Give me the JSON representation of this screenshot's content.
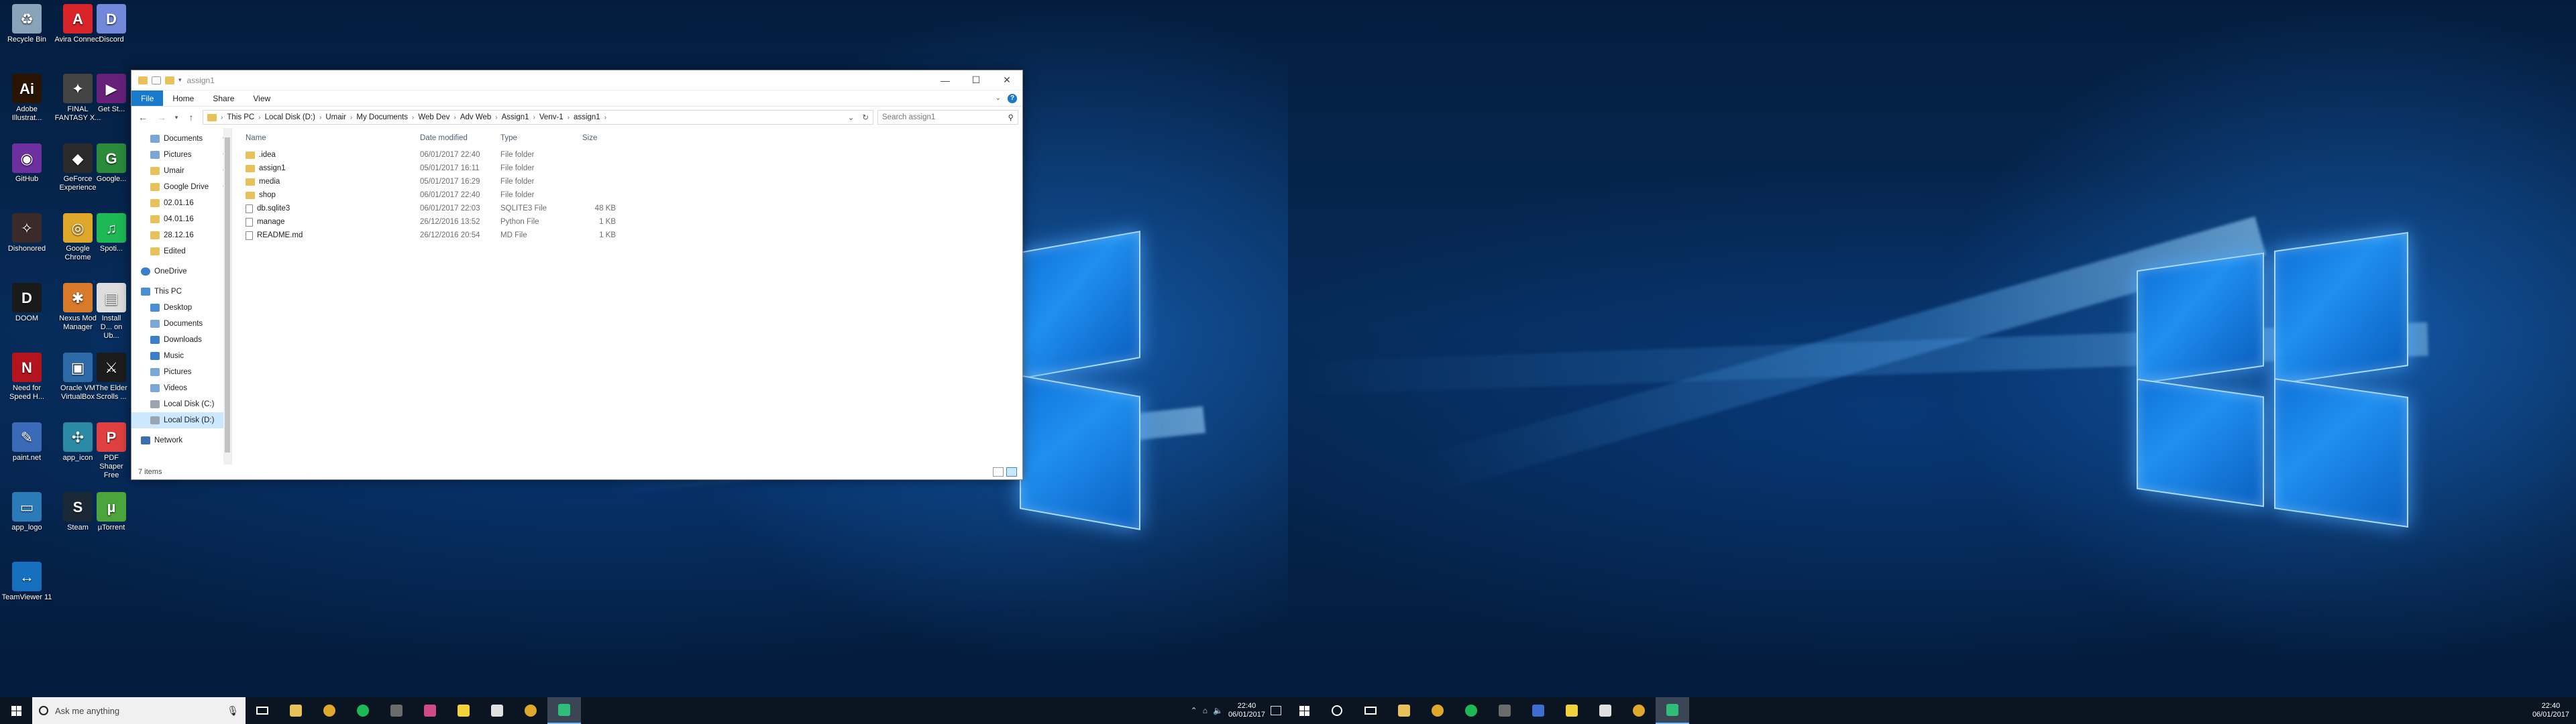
{
  "desktop_icons": [
    {
      "id": "recycle",
      "label": "Recycle Bin",
      "color": "#8aa3b8",
      "glyph": "♻"
    },
    {
      "id": "avira",
      "label": "Avira Connect",
      "color": "#d9252a",
      "glyph": "A"
    },
    {
      "id": "discord",
      "label": "Discord",
      "color": "#7289da",
      "glyph": "D"
    },
    {
      "id": "illustrator",
      "label": "Adobe Illustrat...",
      "color": "#2a1300",
      "glyph": "Ai"
    },
    {
      "id": "ffxv",
      "label": "FINAL FANTASY X...",
      "color": "#444",
      "glyph": "✦"
    },
    {
      "id": "getst",
      "label": "Get St...",
      "color": "#68217a",
      "glyph": "▶"
    },
    {
      "id": "github",
      "label": "GitHub",
      "color": "#6e2fa0",
      "glyph": "◉"
    },
    {
      "id": "geforce",
      "label": "GeForce Experience",
      "color": "#2b2b2b",
      "glyph": "◆"
    },
    {
      "id": "google",
      "label": "Google...",
      "color": "#2a8b3a",
      "glyph": "G"
    },
    {
      "id": "dishonored",
      "label": "Dishonored",
      "color": "#3a2a2a",
      "glyph": "✧"
    },
    {
      "id": "chrome",
      "label": "Google Chrome",
      "color": "#e0a82b",
      "glyph": "◎"
    },
    {
      "id": "spotify",
      "label": "Spoti...",
      "color": "#1db954",
      "glyph": "♫"
    },
    {
      "id": "doom",
      "label": "DOOM",
      "color": "#1a1a1a",
      "glyph": "D"
    },
    {
      "id": "nexus",
      "label": "Nexus Mod Manager",
      "color": "#d9792a",
      "glyph": "✱"
    },
    {
      "id": "install",
      "label": "Install D... on Ub...",
      "color": "#dddddd",
      "glyph": "▤"
    },
    {
      "id": "nfs",
      "label": "Need for Speed H...",
      "color": "#b4141e",
      "glyph": "N"
    },
    {
      "id": "virtualbox",
      "label": "Oracle VM VirtualBox",
      "color": "#2f6aa8",
      "glyph": "▣"
    },
    {
      "id": "skyrim",
      "label": "The Elder Scrolls ...",
      "color": "#1c1c1c",
      "glyph": "⚔"
    },
    {
      "id": "paintnet",
      "label": "paint.net",
      "color": "#3a6ab8",
      "glyph": "✎"
    },
    {
      "id": "appicon",
      "label": "app_icon",
      "color": "#2b8aa6",
      "glyph": "✣"
    },
    {
      "id": "pdfshaper",
      "label": "PDF Shaper Free",
      "color": "#e04040",
      "glyph": "P"
    },
    {
      "id": "applogo",
      "label": "app_logo",
      "color": "#2b7bb8",
      "glyph": "▭"
    },
    {
      "id": "steam",
      "label": "Steam",
      "color": "#1b2838",
      "glyph": "S"
    },
    {
      "id": "utorrent",
      "label": "µTorrent",
      "color": "#4ba53a",
      "glyph": "µ"
    },
    {
      "id": "teamviewer",
      "label": "TeamViewer 11",
      "color": "#1571c0",
      "glyph": "↔"
    }
  ],
  "explorer": {
    "title": "assign1",
    "ribbon_tabs": [
      "File",
      "Home",
      "Share",
      "View"
    ],
    "breadcrumb": [
      "This PC",
      "Local Disk (D:)",
      "Umair",
      "My Documents",
      "Web Dev",
      "Adv Web",
      "Assign1",
      "Venv-1",
      "assign1"
    ],
    "search_placeholder": "Search assign1",
    "columns": {
      "name": "Name",
      "date": "Date modified",
      "type": "Type",
      "size": "Size"
    },
    "files": [
      {
        "name": ".idea",
        "date": "06/01/2017 22:40",
        "type": "File folder",
        "size": "",
        "kind": "folder"
      },
      {
        "name": "assign1",
        "date": "05/01/2017 16:11",
        "type": "File folder",
        "size": "",
        "kind": "folder"
      },
      {
        "name": "media",
        "date": "05/01/2017 16:29",
        "type": "File folder",
        "size": "",
        "kind": "folder"
      },
      {
        "name": "shop",
        "date": "06/01/2017 22:40",
        "type": "File folder",
        "size": "",
        "kind": "folder"
      },
      {
        "name": "db.sqlite3",
        "date": "06/01/2017 22:03",
        "type": "SQLITE3 File",
        "size": "48 KB",
        "kind": "file"
      },
      {
        "name": "manage",
        "date": "26/12/2016 13:52",
        "type": "Python File",
        "size": "1 KB",
        "kind": "file"
      },
      {
        "name": "README.md",
        "date": "26/12/2016 20:54",
        "type": "MD File",
        "size": "1 KB",
        "kind": "file"
      }
    ],
    "quick_access": [
      {
        "label": "Documents",
        "pinned": true,
        "color": "#7aa7d6"
      },
      {
        "label": "Pictures",
        "pinned": true,
        "color": "#7aa7d6"
      },
      {
        "label": "Umair",
        "pinned": true,
        "color": "#e8c15a"
      },
      {
        "label": "Google Drive",
        "pinned": true,
        "color": "#e8c15a"
      },
      {
        "label": "02.01.16",
        "pinned": false,
        "color": "#e8c15a"
      },
      {
        "label": "04.01.16",
        "pinned": false,
        "color": "#e8c15a"
      },
      {
        "label": "28.12.16",
        "pinned": false,
        "color": "#e8c15a"
      },
      {
        "label": "Edited",
        "pinned": false,
        "color": "#e8c15a"
      }
    ],
    "onedrive": "OneDrive",
    "this_pc": "This PC",
    "this_pc_items": [
      {
        "label": "Desktop",
        "color": "#4a8fd6"
      },
      {
        "label": "Documents",
        "color": "#7aa7d6"
      },
      {
        "label": "Downloads",
        "color": "#3a7fc8"
      },
      {
        "label": "Music",
        "color": "#3a7fc8"
      },
      {
        "label": "Pictures",
        "color": "#7aa7d6"
      },
      {
        "label": "Videos",
        "color": "#7aa7d6"
      },
      {
        "label": "Local Disk (C:)",
        "color": "#9aa5b0"
      },
      {
        "label": "Local Disk (D:)",
        "color": "#9aa5b0"
      }
    ],
    "network": "Network",
    "status": "7 items"
  },
  "taskbar": {
    "search_placeholder": "Ask me anything",
    "time": "22:40",
    "date": "06/01/2017",
    "pinned_left": [
      {
        "name": "file-explorer",
        "color": "#e8c15a"
      },
      {
        "name": "chrome",
        "color": "#e0a82b"
      },
      {
        "name": "spotify",
        "color": "#1db954"
      },
      {
        "name": "media-player",
        "color": "#6b6b6b"
      },
      {
        "name": "slack",
        "color": "#d04a8a"
      },
      {
        "name": "sticky-notes",
        "color": "#f2d23a"
      },
      {
        "name": "mail",
        "color": "#e0e0e0"
      },
      {
        "name": "chrome-2",
        "color": "#e0a82b"
      },
      {
        "name": "pycharm",
        "color": "#2fbd7a"
      }
    ],
    "pinned_right": [
      {
        "name": "file-explorer",
        "color": "#e8c15a"
      },
      {
        "name": "chrome",
        "color": "#e0a82b"
      },
      {
        "name": "spotify",
        "color": "#1db954"
      },
      {
        "name": "media-player",
        "color": "#6b6b6b"
      },
      {
        "name": "slack",
        "color": "#3b6ecf"
      },
      {
        "name": "sticky-notes",
        "color": "#f2d23a"
      },
      {
        "name": "mail",
        "color": "#e0e0e0"
      },
      {
        "name": "chrome-2",
        "color": "#e0a82b"
      },
      {
        "name": "pycharm",
        "color": "#2fbd7a"
      }
    ]
  }
}
